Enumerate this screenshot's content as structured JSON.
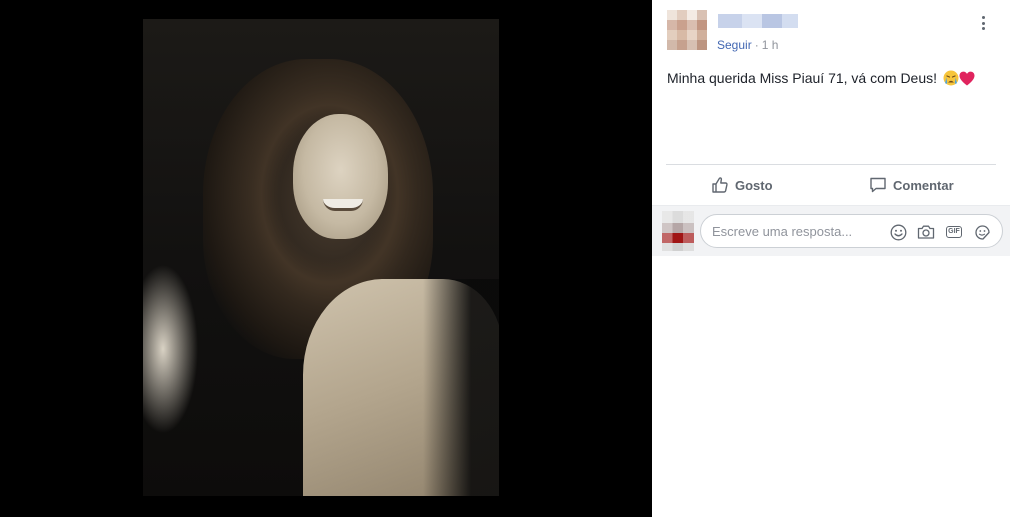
{
  "post": {
    "follow_label": "Seguir",
    "separator": "·",
    "timestamp": "1 h",
    "text": "Minha querida Miss Piauí 71, vá com Deus!",
    "emojis": [
      "crying-face-emoji",
      "red-heart-emoji"
    ]
  },
  "actions": {
    "like_label": "Gosto",
    "comment_label": "Comentar"
  },
  "reply": {
    "placeholder": "Escreve uma resposta...",
    "icons": [
      "smiley-icon",
      "camera-icon",
      "gif-icon",
      "sticker-icon"
    ]
  },
  "colors": {
    "link": "#4267b2",
    "meta_text": "#90949c",
    "body_text": "#1d2129",
    "action_text": "#606770",
    "reply_background": "#f2f3f5"
  }
}
